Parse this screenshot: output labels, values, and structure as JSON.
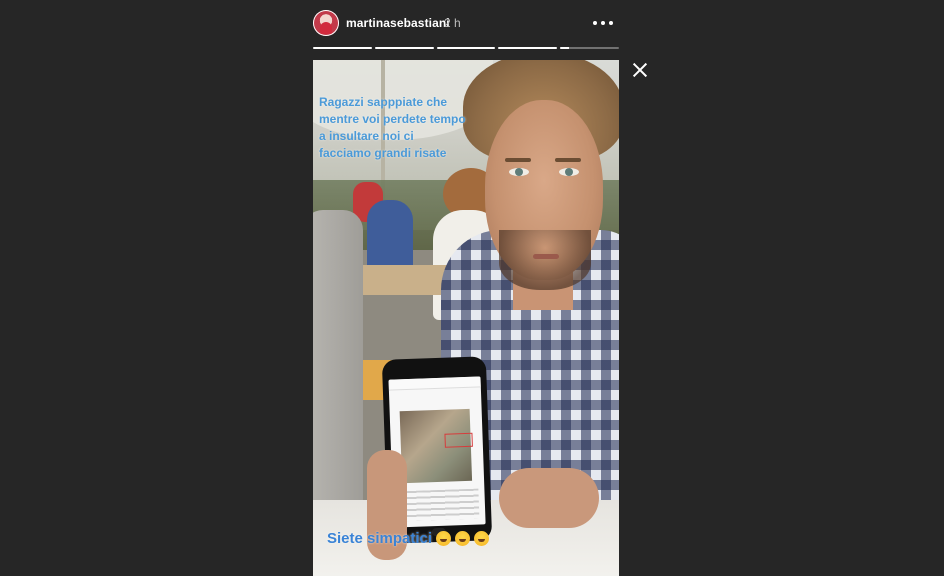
{
  "header": {
    "username": "martinasebastiani",
    "timestamp": "2 h"
  },
  "progress": [
    {
      "value": 1
    },
    {
      "value": 1
    },
    {
      "value": 1
    },
    {
      "value": 1
    },
    {
      "value": 0.15
    }
  ],
  "story": {
    "caption_top": "Ragazzi sapppiate che mentre voi perdete tempo a insultare noi ci facciamo grandi risate",
    "caption_bottom": "Siete simpatici",
    "emoji_icons": [
      "tears-of-joy-emoji",
      "tears-of-joy-emoji",
      "tears-of-joy-emoji"
    ]
  },
  "colors": {
    "background": "#262626",
    "caption": "#3a83d6"
  }
}
